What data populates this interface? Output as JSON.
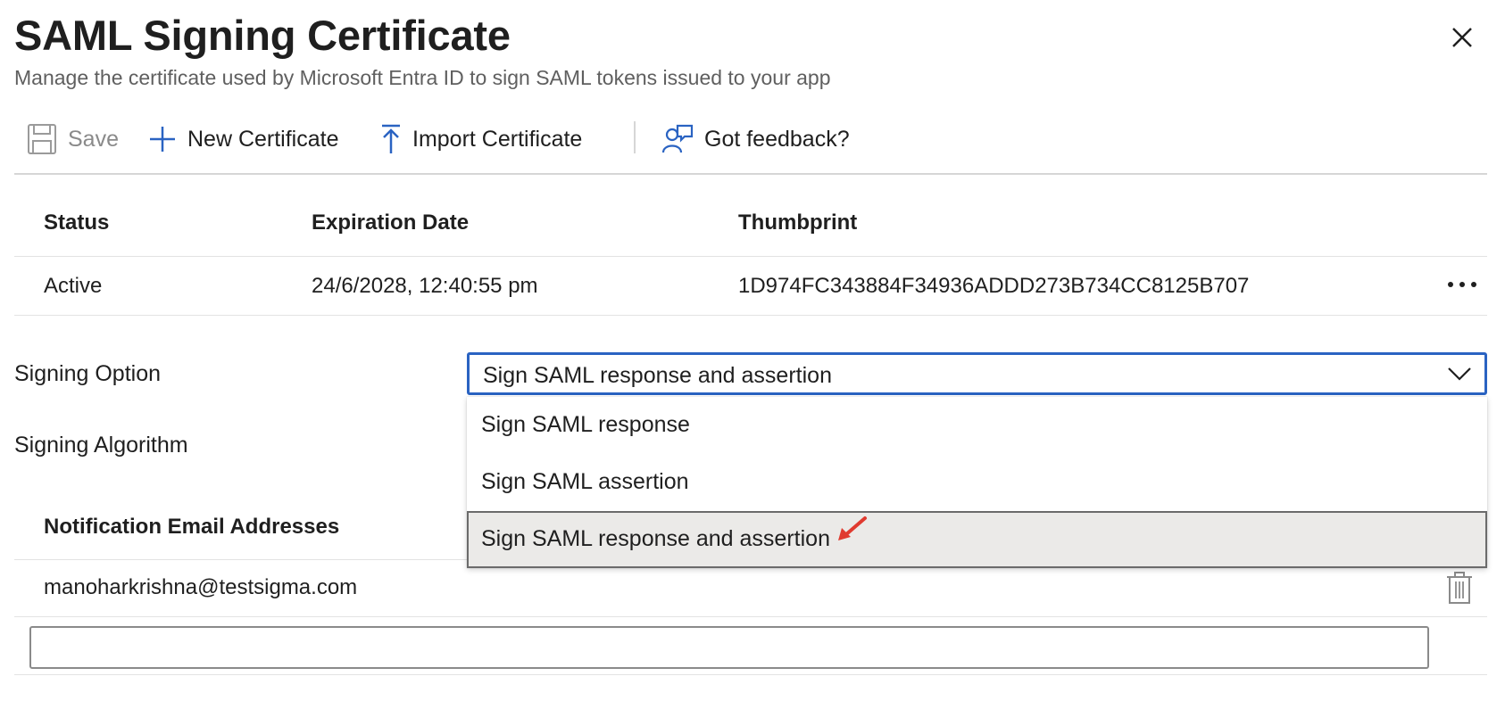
{
  "panel": {
    "title": "SAML Signing Certificate",
    "subtitle": "Manage the certificate used by Microsoft Entra ID to sign SAML tokens issued to your app"
  },
  "toolbar": {
    "save_label": "Save",
    "new_certificate_label": "New Certificate",
    "import_certificate_label": "Import Certificate",
    "feedback_label": "Got feedback?"
  },
  "certificates": {
    "columns": [
      "Status",
      "Expiration Date",
      "Thumbprint"
    ],
    "rows": [
      {
        "status": "Active",
        "expiration": "24/6/2028, 12:40:55 pm",
        "thumbprint": "1D974FC343884F34936ADDD273B734CC8125B707"
      }
    ]
  },
  "signing_option": {
    "label": "Signing Option",
    "selected": "Sign SAML response and assertion",
    "options": [
      "Sign SAML response",
      "Sign SAML assertion",
      "Sign SAML response and assertion"
    ]
  },
  "signing_algorithm": {
    "label": "Signing Algorithm"
  },
  "notification": {
    "header": "Notification Email Addresses",
    "emails": [
      "manoharkrishna@testsigma.com"
    ],
    "new_email_value": ""
  },
  "colors": {
    "accent": "#2a63c2",
    "annotation_arrow": "#e03a2f",
    "disabled_text": "#8a8a8a"
  },
  "icons": {
    "save": "save-icon",
    "new": "plus-icon",
    "import": "upload-arrow-icon",
    "feedback": "feedback-person-icon",
    "close": "close-icon",
    "more": "more-horizontal-icon",
    "chevron": "chevron-down-icon",
    "delete": "trash-icon"
  }
}
